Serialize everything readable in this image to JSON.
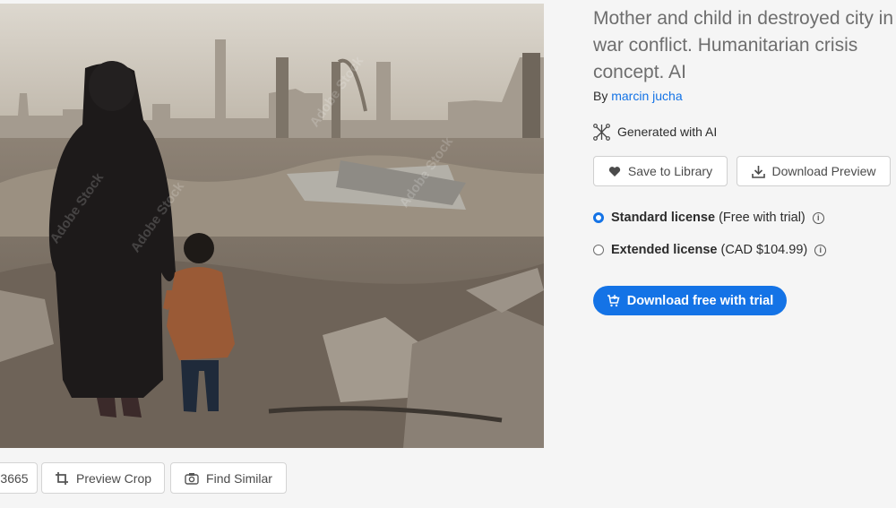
{
  "asset": {
    "title": "Mother and child in destroyed city in war conflict. Humanitarian crisis concept. AI",
    "by_prefix": "By",
    "author": "marcin jucha",
    "generated_label": "Generated with AI",
    "image_alt": "Mother and child walking through rubble of destroyed city"
  },
  "actions": {
    "save_label": "Save to Library",
    "download_preview_label": "Download Preview"
  },
  "licenses": [
    {
      "name": "Standard license",
      "detail": "(Free with trial)",
      "selected": true
    },
    {
      "name": "Extended license",
      "detail": "(CAD $104.99)",
      "selected": false
    }
  ],
  "cta": {
    "label": "Download free with trial"
  },
  "image_tools": {
    "id_fragment": "3665",
    "preview_crop_label": "Preview Crop",
    "find_similar_label": "Find Similar"
  },
  "watermark": {
    "text": "Adobe Stock"
  },
  "colors": {
    "accent": "#1473e6",
    "title_gray": "#6e6e6e"
  }
}
